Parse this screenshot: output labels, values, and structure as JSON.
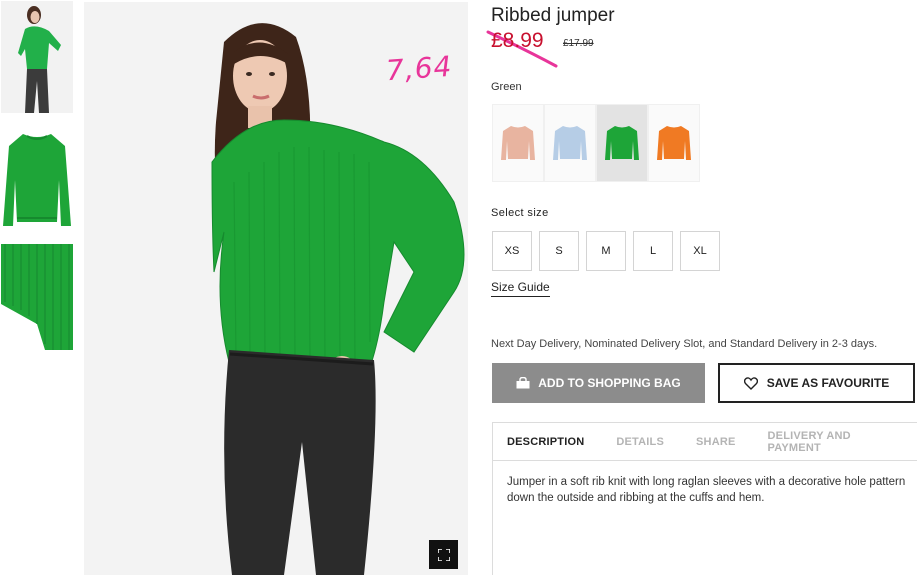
{
  "product": {
    "title": "Ribbed jumper",
    "price_now": "£8.99",
    "price_old": "£17.99"
  },
  "annotation": {
    "handwritten_price": "7,64"
  },
  "colors": {
    "label": "Green",
    "swatches": [
      {
        "name": "pink",
        "hex": "#e8b4a0"
      },
      {
        "name": "light-blue",
        "hex": "#b6cde6"
      },
      {
        "name": "green",
        "hex": "#1ea538",
        "selected": true
      },
      {
        "name": "orange",
        "hex": "#f07a23"
      }
    ]
  },
  "sizes": {
    "label": "Select size",
    "options": [
      "XS",
      "S",
      "M",
      "L",
      "XL"
    ],
    "guide_label": "Size Guide"
  },
  "delivery_text": "Next Day Delivery, Nominated Delivery Slot, and Standard Delivery in 2-3 days.",
  "actions": {
    "add_to_bag": "ADD TO SHOPPING BAG",
    "save_favourite": "SAVE AS FAVOURITE"
  },
  "tabs": [
    {
      "label": "DESCRIPTION",
      "active": true
    },
    {
      "label": "DETAILS"
    },
    {
      "label": "SHARE"
    },
    {
      "label": "DELIVERY AND PAYMENT"
    }
  ],
  "description": {
    "line1": "Jumper in a soft rib knit with long raglan sleeves with a decorative hole pattern",
    "line2": "down the outside and ribbing at the cuffs and hem."
  },
  "theme": {
    "sale_red": "#c8102e",
    "annotation_pink": "#e8359a",
    "button_grey": "#8c8c8c"
  }
}
